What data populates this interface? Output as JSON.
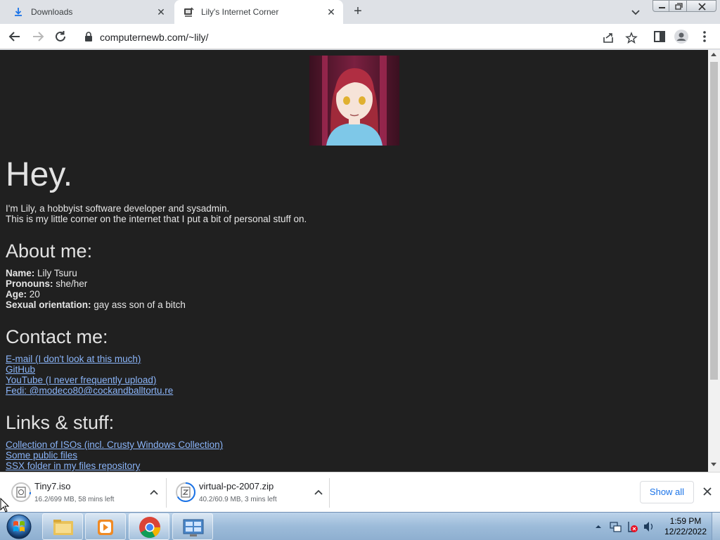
{
  "browser": {
    "tabs": [
      {
        "title": "Downloads",
        "icon": "download-icon"
      },
      {
        "title": "Lily's Internet Corner",
        "icon": "site-favicon"
      }
    ],
    "url": "computernewb.com/~lily/"
  },
  "page": {
    "hero_title": "Hey.",
    "intro_line1": "I'm Lily, a hobbyist software developer and sysadmin.",
    "intro_line2": "This is my little corner on the internet that I put a bit of personal stuff on.",
    "about": {
      "heading": "About me:",
      "name_label": "Name:",
      "name_value": "Lily Tsuru",
      "pronouns_label": "Pronouns:",
      "pronouns_value": "she/her",
      "age_label": "Age:",
      "age_value": "20",
      "orientation_label": "Sexual orientation:",
      "orientation_value": "gay ass son of a bitch"
    },
    "contact": {
      "heading": "Contact me:",
      "links": [
        "E-mail (I don't look at this much)",
        "GitHub",
        "YouTube (I never frequently upload)",
        "Fedi: @modeco80@cockandballtortu.re"
      ]
    },
    "links_stuff": {
      "heading": "Links & stuff:",
      "links": [
        "Collection of ISOs (incl. Crusty Windows Collection)",
        "Some public files",
        "SSX folder in my files repository"
      ]
    },
    "link_color": "#8ab4f8",
    "background_color": "#202020"
  },
  "downloads": {
    "items": [
      {
        "name": "Tiny7.iso",
        "status": "16.2/699 MB, 58 mins left"
      },
      {
        "name": "virtual-pc-2007.zip",
        "status": "40.2/60.9 MB, 3 mins left"
      }
    ],
    "show_all_label": "Show all"
  },
  "taskbar": {
    "time": "1:59 PM",
    "date": "12/22/2022"
  }
}
